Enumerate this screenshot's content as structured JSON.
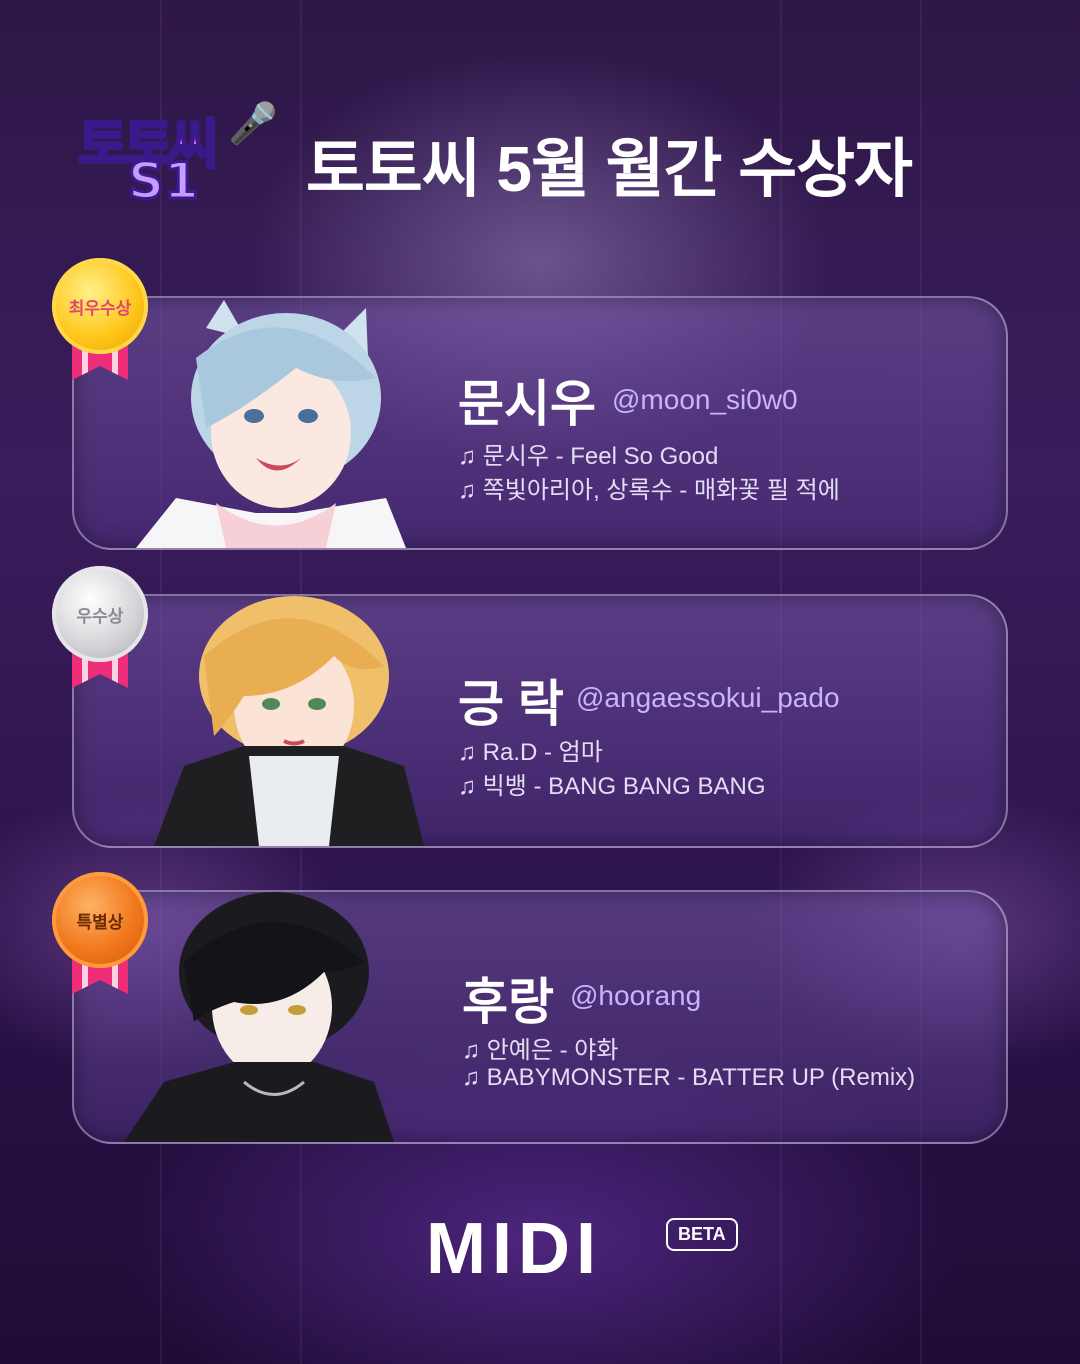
{
  "logo": {
    "line1": "토토씨",
    "line2": "S1"
  },
  "title": "토토씨 5월 월간 수상자",
  "awards": [
    {
      "badge": "최우수상",
      "name": "문시우",
      "handle": "@moon_si0w0",
      "songs": [
        "♫ 문시우 - Feel So Good",
        "♫ 쪽빛아리아, 상록수 - 매화꽃 필 적에"
      ]
    },
    {
      "badge": "우수상",
      "name": "긍 락",
      "handle": "@angaessokui_pado",
      "songs": [
        "♫ Ra.D - 엄마",
        "♫ 빅뱅 - BANG BANG BANG"
      ]
    },
    {
      "badge": "특별상",
      "name": "후랑",
      "handle": "@hoorang",
      "songs": [
        "♫ 안예은 - 야화",
        "♫ BABYMONSTER - BATTER UP (Remix)"
      ]
    }
  ],
  "brand": {
    "name": "MIDI",
    "tag": "BETA"
  },
  "colors": {
    "gold": "#ffc61a",
    "silver": "#d4d4d8",
    "bronze": "#f0761a",
    "accent": "#c8b3ff"
  }
}
